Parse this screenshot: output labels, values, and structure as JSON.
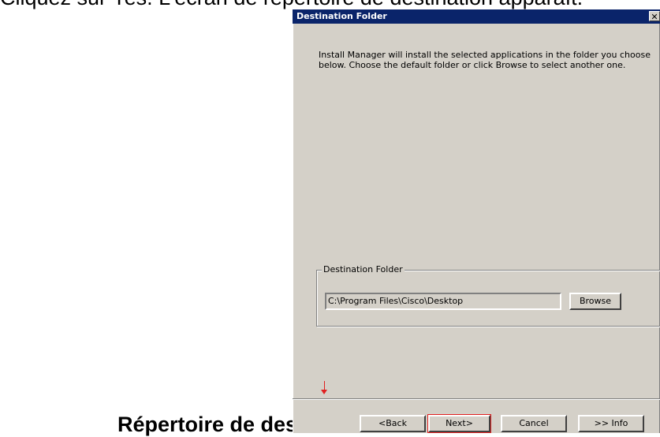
{
  "page": {
    "top_text": "Cliquez sur Yes. L'écran de répertoire de destination apparaît.",
    "bottom_heading": "Répertoire de destination"
  },
  "dialog": {
    "title": "Destination Folder",
    "close_glyph": "✕",
    "description": "Install Manager will install the selected applications in the folder you choose below. Choose the default folder or click Browse to select another one.",
    "group_label": "Destination Folder",
    "path_value": "C:\\Program Files\\Cisco\\Desktop",
    "browse_label": "Browse",
    "buttons": {
      "back": "<Back",
      "next": "Next>",
      "cancel": "Cancel",
      "info": ">> Info"
    }
  },
  "annotation": {
    "highlight_color": "#e02020",
    "target": "next-button"
  }
}
